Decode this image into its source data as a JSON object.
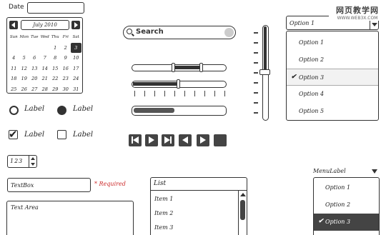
{
  "date": {
    "label": "Date",
    "value": ""
  },
  "calendar": {
    "month": "July 2010",
    "days_of_week": [
      "Sun",
      "Mon",
      "Tue",
      "Wed",
      "Thu",
      "Fri",
      "Sat"
    ],
    "weeks": [
      [
        "",
        "",
        "",
        "",
        "1",
        "2",
        "3"
      ],
      [
        "4",
        "5",
        "6",
        "7",
        "8",
        "9",
        "10"
      ],
      [
        "11",
        "12",
        "13",
        "14",
        "15",
        "16",
        "17"
      ],
      [
        "18",
        "19",
        "20",
        "21",
        "22",
        "23",
        "24"
      ],
      [
        "25",
        "26",
        "27",
        "28",
        "29",
        "30",
        "31"
      ]
    ],
    "selected_day": "3"
  },
  "radios": [
    {
      "label": "Label",
      "checked": false
    },
    {
      "label": "Label",
      "checked": true
    }
  ],
  "checkboxes": [
    {
      "label": "Label",
      "checked": true
    },
    {
      "label": "Label",
      "checked": false
    }
  ],
  "stepper": {
    "value": "123"
  },
  "textbox": {
    "value": "TextBox"
  },
  "required": {
    "text": "* Required"
  },
  "textarea": {
    "value": "Text Area"
  },
  "search": {
    "placeholder": "Search"
  },
  "range_slider": {
    "low": 0.45,
    "high": 0.75
  },
  "slider": {
    "value": 0.5
  },
  "progress": {
    "value": 0.45
  },
  "dropdown": {
    "selected": "Option 1",
    "options": [
      "Option 1",
      "Option 2",
      "Option 3",
      "Option 4",
      "Option 5"
    ],
    "checked_option": "Option 3",
    "check_symbol": "✔"
  },
  "vertical_slider": {
    "value": 0.5
  },
  "list": {
    "header": "List",
    "items": [
      "Item 1",
      "Item 2",
      "Item 3"
    ]
  },
  "menu": {
    "label": "MenuLabel",
    "items": [
      "Option 1",
      "Option 2",
      "Option 3"
    ],
    "selected": "Option 3"
  },
  "watermark": {
    "main": "网页教学网",
    "sub": "WWW.WEB3X.COM"
  }
}
